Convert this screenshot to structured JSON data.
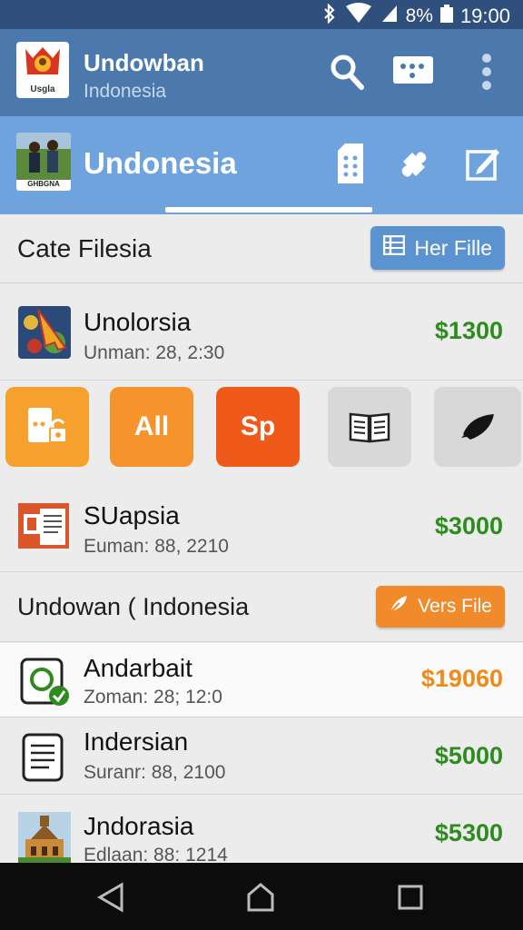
{
  "status_bar": {
    "battery": "8%",
    "time": "19:00"
  },
  "appbar_top": {
    "title": "Undowban",
    "subtitle": "Indonesia",
    "logo_text": "Usgla",
    "icons": [
      "search-icon",
      "dial-pad-icon",
      "more-vert-icon"
    ]
  },
  "appbar_second": {
    "title": "Undonesia",
    "logo_text": "GHBGNA",
    "icons": [
      "sim-card-icon",
      "puzzle-icon",
      "edit-icon"
    ]
  },
  "section1": {
    "title": "Cate Filesia",
    "button": "Her Fille"
  },
  "rows1": [
    {
      "name": "Unolorsia",
      "meta": "Unman: 28, 2:30",
      "price": "$1300",
      "price_color": "#2e8b1e"
    }
  ],
  "tiles": [
    {
      "label": "",
      "color": "#f6a12e",
      "icon": "file-lock-icon"
    },
    {
      "label": "All",
      "color": "#f7932b",
      "icon": ""
    },
    {
      "label": "Sp",
      "color": "#ef5a1b",
      "icon": ""
    },
    {
      "label": "",
      "color": "#d8d8d8",
      "icon": "book-icon"
    },
    {
      "label": "",
      "color": "#d8d8d8",
      "icon": "rocket-icon"
    }
  ],
  "rows2": [
    {
      "name": "SUapsia",
      "meta": "Euman: 88, 2210",
      "price": "$3000",
      "price_color": "#2e8b1e"
    }
  ],
  "section2": {
    "title": "Undowan ( Indonesia",
    "button": "Vers File"
  },
  "rows3": [
    {
      "name": "Andarbait",
      "meta": "Zoman: 28; 12:0",
      "price": "$19060",
      "price_color": "#f08a1a"
    },
    {
      "name": "Indersian",
      "meta": "Suranr: 88, 2100",
      "price": "$5000",
      "price_color": "#2e8b1e"
    },
    {
      "name": "Jndorasia",
      "meta": "Edlaan: 88: 1214",
      "price": "$5300",
      "price_color": "#2e8b1e"
    }
  ],
  "colors": {
    "primary_dark": "#4b79ad",
    "primary_light": "#6fa3dd",
    "accent_orange": "#f08a2a",
    "price_green": "#2e8b1e"
  }
}
